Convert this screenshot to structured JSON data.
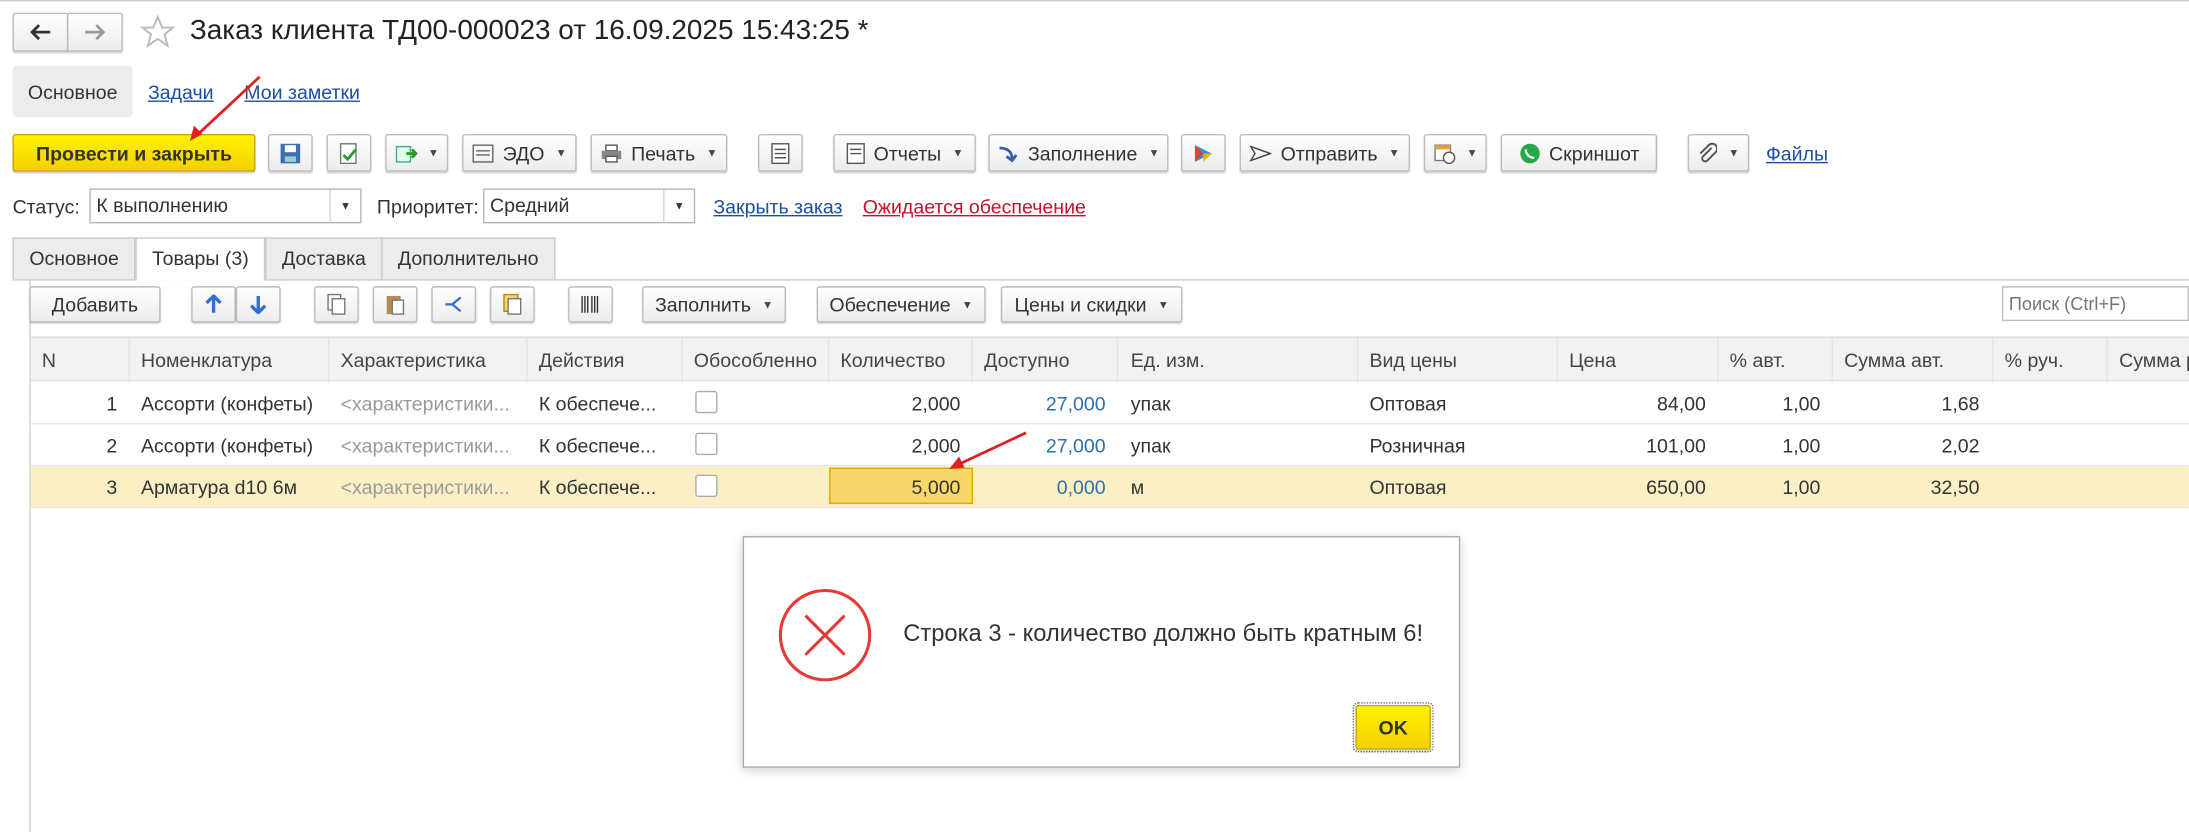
{
  "header": {
    "title": "Заказ клиента ТД00-000023 от 16.09.2025 15:43:25 *"
  },
  "nav": {
    "tabs": [
      "Основное",
      "Задачи",
      "Мои заметки"
    ]
  },
  "toolbar": {
    "post_close": "Провести и закрыть",
    "edo": "ЭДО",
    "print": "Печать",
    "reports": "Отчеты",
    "fill": "Заполнение",
    "send": "Отправить",
    "screenshot": "Скриншот",
    "files": "Файлы"
  },
  "status": {
    "label": "Статус:",
    "value": "К выполнению",
    "priority_label": "Приоритет:",
    "priority_value": "Средний",
    "close_order": "Закрыть заказ",
    "awaiting": "Ожидается обеспечение",
    "awaiting_color": "#c8102e"
  },
  "tabs": [
    "Основное",
    "Товары (3)",
    "Доставка",
    "Дополнительно"
  ],
  "goods_toolbar": {
    "add": "Добавить",
    "fill": "Заполнить",
    "supply": "Обеспечение",
    "prices": "Цены и скидки",
    "search_placeholder": "Поиск (Ctrl+F)"
  },
  "table": {
    "columns": [
      "N",
      "Номенклатура",
      "Характеристика",
      "Действия",
      "Обособленно",
      "Количество",
      "Доступно",
      "Ед. изм.",
      "Вид цены",
      "Цена",
      "% авт.",
      "Сумма авт.",
      "% руч.",
      "Сумма р"
    ],
    "rows": [
      {
        "n": "1",
        "name": "Ассорти (конфеты)",
        "char": "<характеристики...",
        "action": "К обеспече...",
        "qty": "2,000",
        "avail": "27,000",
        "unit": "упак",
        "ptype": "Оптовая",
        "price": "84,00",
        "pct": "1,00",
        "sum": "1,68"
      },
      {
        "n": "2",
        "name": "Ассорти (конфеты)",
        "char": "<характеристики...",
        "action": "К обеспече...",
        "qty": "2,000",
        "avail": "27,000",
        "unit": "упак",
        "ptype": "Розничная",
        "price": "101,00",
        "pct": "1,00",
        "sum": "2,02"
      },
      {
        "n": "3",
        "name": "Арматура d10 6м",
        "char": "<характеристики...",
        "action": "К обеспече...",
        "qty": "5,000",
        "avail": "0,000",
        "unit": "м",
        "ptype": "Оптовая",
        "price": "650,00",
        "pct": "1,00",
        "sum": "32,50"
      }
    ]
  },
  "dialog": {
    "message": "Строка 3 - количество должно быть кратным 6!",
    "ok": "OK"
  },
  "colors": {
    "accent_yellow": "#f4d000",
    "link_blue": "#1b4fa3",
    "error_red": "#e53935",
    "annotation_arrow": "#e02020"
  }
}
